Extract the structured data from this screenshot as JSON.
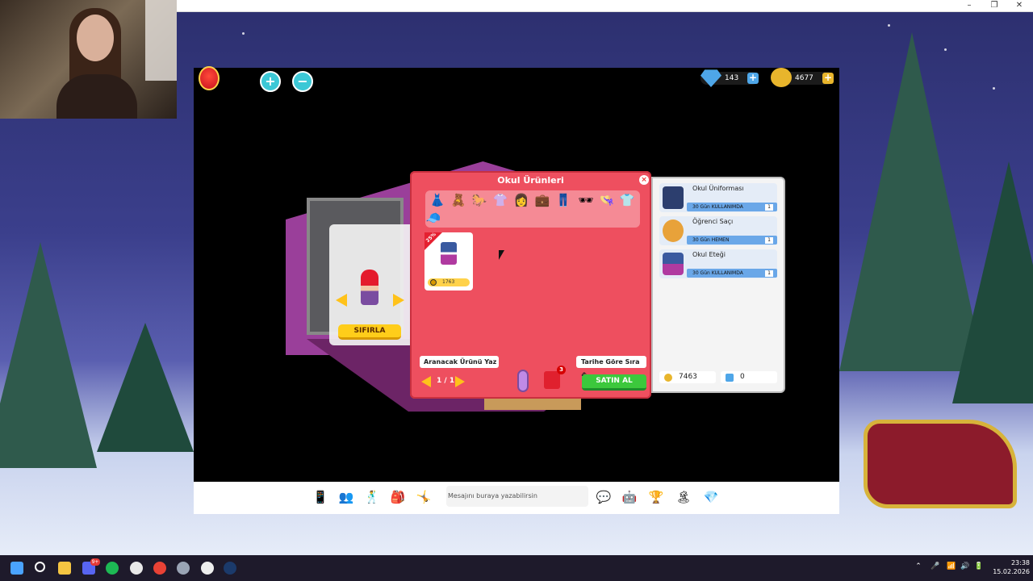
{
  "window": {
    "minimize_symbol": "–",
    "maximize_symbol": "❐",
    "close_symbol": "✕"
  },
  "game": {
    "zoom_in_label": "+",
    "zoom_out_label": "−",
    "diamonds": "143",
    "gold": "4677",
    "plus_label": "+"
  },
  "avatar_preview": {
    "reset_label": "SIFIRLA"
  },
  "shop": {
    "title": "Okul Ürünleri",
    "close_label": "×",
    "categories": [
      "dress",
      "bear",
      "rocking-horse",
      "skirt",
      "hair",
      "bag",
      "jeans",
      "glasses",
      "hat",
      "shirt",
      "cap"
    ],
    "item": {
      "discount": "25%",
      "price": "1763"
    },
    "search_placeholder": "Aranacak Ürünü Yaz",
    "sort_label": "Tarihe Göre Sıra ⏏",
    "pager": "1 / 1",
    "cart_count": "3",
    "buy_label": "SATIN AL"
  },
  "cart": {
    "items": [
      {
        "name": "Okul Üniforması",
        "duration": "30 Gün KULLANIMDA",
        "qty": "1"
      },
      {
        "name": "Öğrenci Saçı",
        "duration": "30 Gün HEMEN",
        "qty": "1"
      },
      {
        "name": "Okul Eteği",
        "duration": "30 Gün KULLANIMDA",
        "qty": "1"
      }
    ],
    "total_gold": "7463",
    "total_diamonds": "0"
  },
  "gamebar": {
    "chat_placeholder": "Mesajını buraya yazabilirsin"
  },
  "taskbar": {
    "time": "23:38",
    "date": "15.02.2026",
    "discord_badge": "9+"
  },
  "colors": {
    "shop_bg": "#ee4f5f",
    "buy_green": "#3cc83c",
    "coin_yellow": "#ffd24a",
    "diamond_blue": "#4ea6e8"
  }
}
